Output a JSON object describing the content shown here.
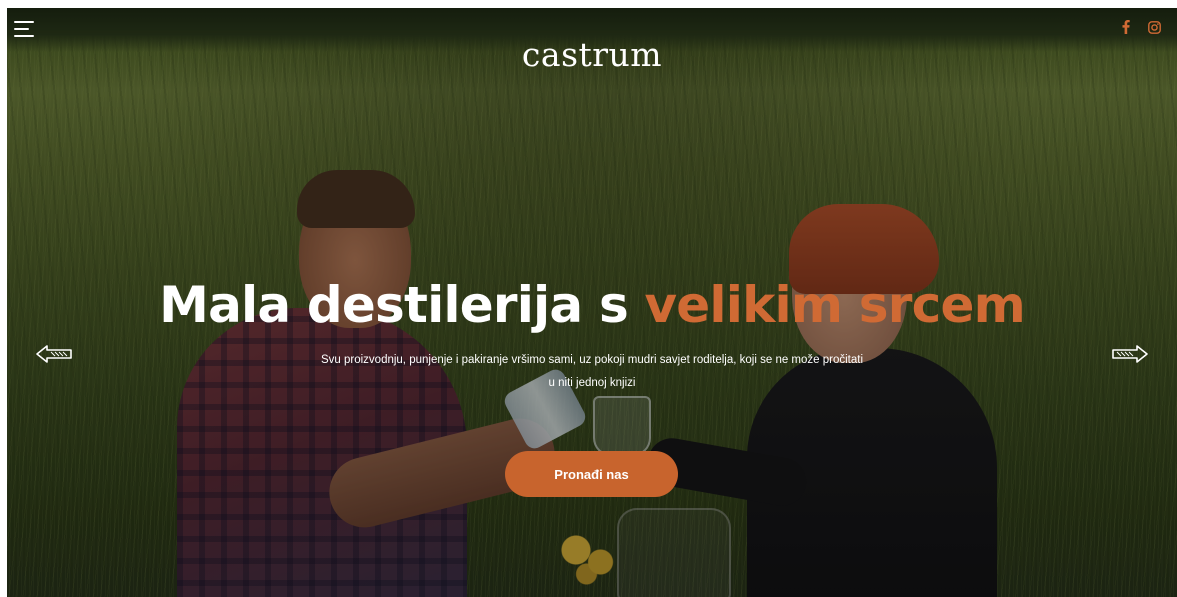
{
  "brand": {
    "logo_text": "castrum"
  },
  "header": {
    "menu_icon": "hamburger-menu-icon",
    "social": [
      {
        "name": "facebook",
        "icon": "facebook-icon"
      },
      {
        "name": "instagram",
        "icon": "instagram-icon"
      }
    ]
  },
  "hero": {
    "headline_plain": "Mala destilerija s ",
    "headline_accent": "velikim srcem",
    "subtext_line1": "Svu proizvodnju, punjenje i pakiranje vršimo sami, uz pokoji mudri savjet roditelja, koji se ne može pročitati",
    "subtext_line2": "u niti jednoj knjizi",
    "cta_label": "Pronađi nas",
    "prev_icon": "arrow-left-icon",
    "next_icon": "arrow-right-icon"
  },
  "colors": {
    "accent": "#d06a34",
    "button": "#c8642d",
    "text": "#ffffff"
  }
}
